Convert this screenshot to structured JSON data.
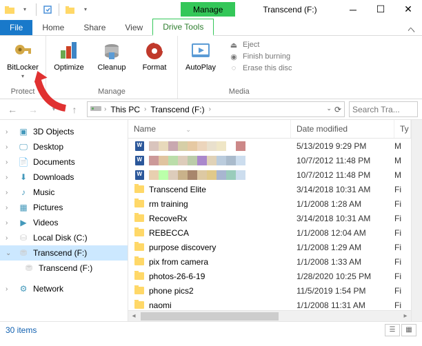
{
  "titlebar": {
    "context_tab": "Manage",
    "title": "Transcend (F:)"
  },
  "tabs": {
    "file": "File",
    "home": "Home",
    "share": "Share",
    "view": "View",
    "drive_tools": "Drive Tools"
  },
  "ribbon": {
    "protect": {
      "bitlocker": "BitLocker",
      "label": "Protect"
    },
    "manage": {
      "optimize": "Optimize",
      "cleanup": "Cleanup",
      "format": "Format",
      "label": "Manage"
    },
    "media": {
      "autoplay": "AutoPlay",
      "eject": "Eject",
      "finish_burning": "Finish burning",
      "erase": "Erase this disc",
      "label": "Media"
    }
  },
  "breadcrumb": {
    "root": "This PC",
    "drive": "Transcend (F:)"
  },
  "search_placeholder": "Search Tra...",
  "tree": [
    {
      "label": "3D Objects",
      "icon": "cube"
    },
    {
      "label": "Desktop",
      "icon": "desktop"
    },
    {
      "label": "Documents",
      "icon": "doc"
    },
    {
      "label": "Downloads",
      "icon": "down"
    },
    {
      "label": "Music",
      "icon": "music"
    },
    {
      "label": "Pictures",
      "icon": "pic"
    },
    {
      "label": "Videos",
      "icon": "vid"
    },
    {
      "label": "Local Disk (C:)",
      "icon": "disk"
    },
    {
      "label": "Transcend (F:)",
      "icon": "drive",
      "selected": true
    },
    {
      "label": "Transcend (F:)",
      "icon": "drive",
      "sub": true
    },
    {
      "label": "Network",
      "icon": "net",
      "spaced": true
    }
  ],
  "columns": {
    "name": "Name",
    "date": "Date modified",
    "type": "Ty"
  },
  "files": [
    {
      "kind": "word-blur",
      "date": "5/13/2019 9:29 PM",
      "type": "M"
    },
    {
      "kind": "word-blur",
      "date": "10/7/2012 11:48 PM",
      "type": "M"
    },
    {
      "kind": "word-blur",
      "date": "10/7/2012 11:48 PM",
      "type": "M"
    },
    {
      "kind": "folder",
      "name": "Transcend Elite",
      "date": "3/14/2018 10:31 AM",
      "type": "Fi"
    },
    {
      "kind": "folder",
      "name": "rm training",
      "date": "1/1/2008 1:28 AM",
      "type": "Fi"
    },
    {
      "kind": "folder",
      "name": "RecoveRx",
      "date": "3/14/2018 10:31 AM",
      "type": "Fi"
    },
    {
      "kind": "folder",
      "name": "REBECCA",
      "date": "1/1/2008 12:04 AM",
      "type": "Fi"
    },
    {
      "kind": "folder",
      "name": "purpose discovery",
      "date": "1/1/2008 1:29 AM",
      "type": "Fi"
    },
    {
      "kind": "folder",
      "name": "pix from camera",
      "date": "1/1/2008 1:33 AM",
      "type": "Fi"
    },
    {
      "kind": "folder",
      "name": "photos-26-6-19",
      "date": "1/28/2020 10:25 PM",
      "type": "Fi"
    },
    {
      "kind": "folder",
      "name": "phone pics2",
      "date": "11/5/2019 1:54 PM",
      "type": "Fi"
    },
    {
      "kind": "folder",
      "name": "naomi",
      "date": "1/1/2008 11:31 AM",
      "type": "Fi"
    }
  ],
  "status": {
    "count": "30 items"
  }
}
